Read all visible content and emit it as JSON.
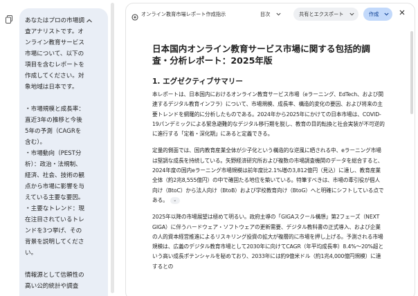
{
  "chat": {
    "prompt_text": "あなたはプロの市場調査アナリストです。オンライン教育サービス市場について、以下の項目を含むレポートを作成してください。対象地域は日本です。\n\n・市場規模と成長率：直近3年の推移と今後5年の予測（CAGRを含む）。\n・市場動向（PEST分析）：政治・法規制、経済、社会、技術の観点から市場に影響を与えている主要な要因。\n・主要なトレンド：現在注目されているトレンドを3つ挙げ、その背景を説明してください。\n\n情報源として信頼性の高い公的統計や調査",
    "collapse_icon": "chevron-up-icon"
  },
  "canvas": {
    "title": "オンライン教育市場レポート作成指示",
    "toc_label": "目次",
    "share_label": "共有とエクスポート",
    "create_label": "作成",
    "icons": {
      "doc": "document-sparkle-icon",
      "close": "close-icon"
    }
  },
  "document": {
    "heading": "日本国内オンライン教育サービス市場に関する包括的調査・分析レポート：2025年版",
    "section_title": "1. エグゼクティブサマリー",
    "paragraphs": [
      "本レポートは、日本国内におけるオンライン教育サービス市場（eラーニング、EdTech、および関連するデジタル教育インフラ）について、市場規模、成長率、構造的変化の要因、および将来の主要トレンドを網羅的に分析したものである。2024年から2025年にかけての日本市場は、COVID-19パンデミックによる緊急避難的なデジタル移行期を脱し、教育の目的転換と社会実装が不可逆的に進行する「定着・深化期」にあると定義できる。",
      "定量的側面では、国内教育産業全体が少子化という構造的な逆風に晒される中、eラーニング市場は堅調な成長を持続している。矢野経済研究所および複数の市場調査機関のデータを総合すると、2024年度の国内eラーニング市場規模は前年度比2.1%増の3,812億円（見込）に達し、教育産業全体（約2兆8,555億円）の中で確固たる地位を築いている。特筆すべきは、市場の牽引役が個人向け（BtoC）から法人向け（BtoB）および学校教育向け（BtoG）へと明確にシフトしている点である。",
      "2025年以降の市場展望は極めて明るい。政府主導の「GIGAスクール構想」第2フェーズ（NEXT GIGA）に伴うハードウェア・ソフトウェアの更新需要、デジタル教科書の正式導入、および企業の人的資本経営推進によるリスキリング投資の拡大が複層的に市場を押し上げる。予測される市場規模は、広義のデジタル教育市場として2030年に向けてCAGR（年平均成長率）8.4%〜20%超という高い成長ポテンシャルを秘めており、2033年には約9億米ドル（約1兆4,000億円規模）に達するとの"
    ],
    "more_chip": "⌄"
  }
}
